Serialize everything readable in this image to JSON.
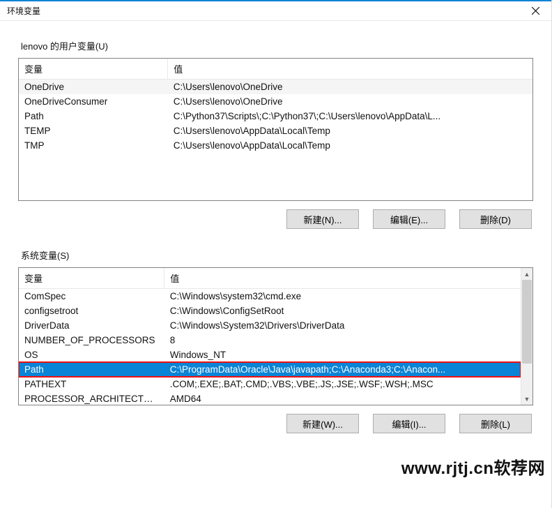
{
  "window": {
    "title": "环境变量"
  },
  "user_section": {
    "label": "lenovo 的用户变量(U)",
    "headers": {
      "variable": "变量",
      "value": "值"
    },
    "rows": [
      {
        "variable": "OneDrive",
        "value": "C:\\Users\\lenovo\\OneDrive"
      },
      {
        "variable": "OneDriveConsumer",
        "value": "C:\\Users\\lenovo\\OneDrive"
      },
      {
        "variable": "Path",
        "value": "C:\\Python37\\Scripts\\;C:\\Python37\\;C:\\Users\\lenovo\\AppData\\L..."
      },
      {
        "variable": "TEMP",
        "value": "C:\\Users\\lenovo\\AppData\\Local\\Temp"
      },
      {
        "variable": "TMP",
        "value": "C:\\Users\\lenovo\\AppData\\Local\\Temp"
      }
    ],
    "buttons": {
      "new": "新建(N)...",
      "edit": "编辑(E)...",
      "delete": "删除(D)"
    }
  },
  "system_section": {
    "label": "系统变量(S)",
    "headers": {
      "variable": "变量",
      "value": "值"
    },
    "rows": [
      {
        "variable": "ComSpec",
        "value": "C:\\Windows\\system32\\cmd.exe"
      },
      {
        "variable": "configsetroot",
        "value": "C:\\Windows\\ConfigSetRoot"
      },
      {
        "variable": "DriverData",
        "value": "C:\\Windows\\System32\\Drivers\\DriverData"
      },
      {
        "variable": "NUMBER_OF_PROCESSORS",
        "value": "8"
      },
      {
        "variable": "OS",
        "value": "Windows_NT"
      },
      {
        "variable": "Path",
        "value": "C:\\ProgramData\\Oracle\\Java\\javapath;C:\\Anaconda3;C:\\Anacon...",
        "selected": true
      },
      {
        "variable": "PATHEXT",
        "value": ".COM;.EXE;.BAT;.CMD;.VBS;.VBE;.JS;.JSE;.WSF;.WSH;.MSC"
      },
      {
        "variable": "PROCESSOR_ARCHITECTURE",
        "value": "AMD64"
      }
    ],
    "buttons": {
      "new": "新建(W)...",
      "edit": "编辑(I)...",
      "delete": "删除(L)"
    }
  },
  "watermark": "www.rjtj.cn软荐网"
}
